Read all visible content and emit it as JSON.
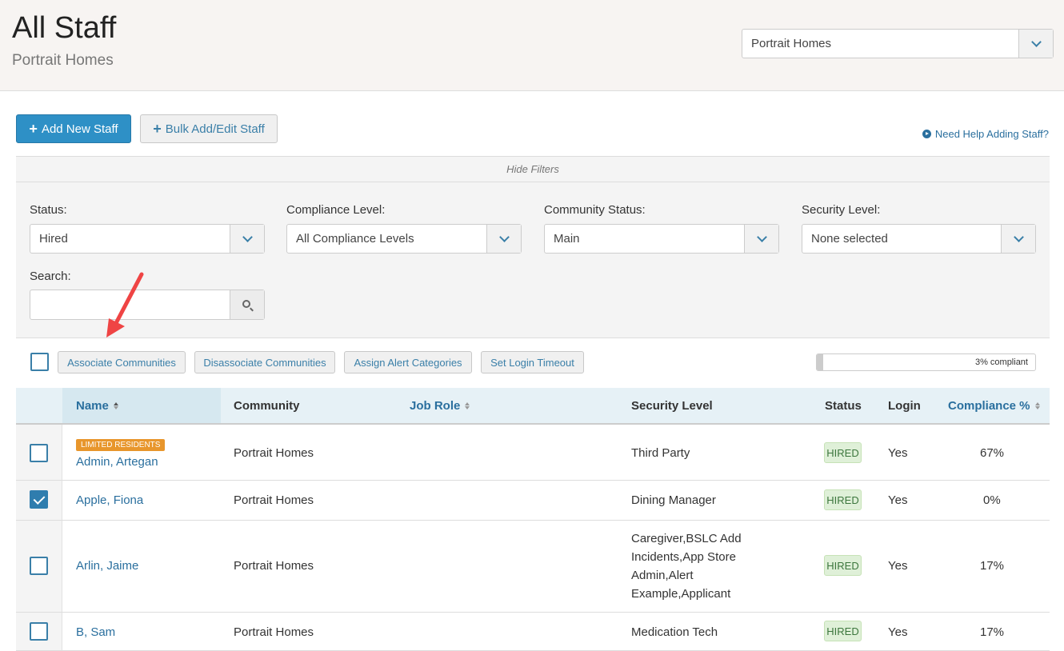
{
  "header": {
    "title": "All Staff",
    "subtitle": "Portrait Homes",
    "community_select": "Portrait Homes"
  },
  "actions": {
    "add_new_staff": "Add New Staff",
    "bulk_add_edit": "Bulk Add/Edit Staff",
    "help_link": "Need Help Adding Staff?"
  },
  "filters": {
    "toggle": "Hide Filters",
    "status": {
      "label": "Status:",
      "value": "Hired"
    },
    "compliance_level": {
      "label": "Compliance Level:",
      "value": "All Compliance Levels"
    },
    "community_status": {
      "label": "Community Status:",
      "value": "Main"
    },
    "security_level": {
      "label": "Security Level:",
      "value": "None selected"
    },
    "search": {
      "label": "Search:",
      "value": ""
    }
  },
  "toolbar": {
    "associate": "Associate Communities",
    "disassociate": "Disassociate Communities",
    "assign_alert": "Assign Alert Categories",
    "set_login_timeout": "Set Login Timeout",
    "compliance_text": "3% compliant",
    "compliance_fraction": 0.03
  },
  "table": {
    "columns": {
      "name": "Name",
      "community": "Community",
      "job_role": "Job Role",
      "security_level": "Security Level",
      "status": "Status",
      "login": "Login",
      "compliance": "Compliance %"
    },
    "rows": [
      {
        "badge": "LIMITED RESIDENTS",
        "name": "Admin, Artegan",
        "community": "Portrait Homes",
        "job_role": "",
        "security": "Third Party",
        "status": "HIRED",
        "login": "Yes",
        "compliance": "67%",
        "checked": false
      },
      {
        "name": "Apple, Fiona",
        "community": "Portrait Homes",
        "job_role": "",
        "security": "Dining Manager",
        "status": "HIRED",
        "login": "Yes",
        "compliance": "0%",
        "checked": true
      },
      {
        "name": "Arlin, Jaime",
        "community": "Portrait Homes",
        "job_role": "",
        "security_lines": [
          "Caregiver,BSLC Add",
          "Incidents,App Store",
          "Admin,Alert",
          "Example,Applicant"
        ],
        "status": "HIRED",
        "login": "Yes",
        "compliance": "17%",
        "checked": false
      },
      {
        "name": "B, Sam",
        "community": "Portrait Homes",
        "job_role": "",
        "security": "Medication Tech",
        "status": "HIRED",
        "login": "Yes",
        "compliance": "17%",
        "checked": false
      }
    ]
  },
  "colors": {
    "primary": "#2e90c6",
    "link": "#2a6f9e",
    "badge_orange": "#e8962c",
    "hired_bg": "#dff0d8",
    "hired_text": "#3c763d",
    "annotation_arrow": "#ef4444"
  }
}
